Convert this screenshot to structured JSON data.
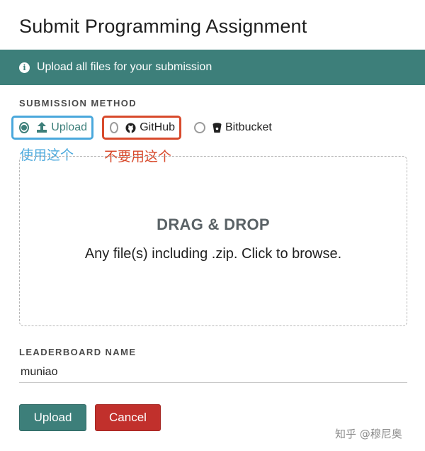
{
  "modal": {
    "title": "Submit Programming Assignment"
  },
  "banner": {
    "icon": "info-icon",
    "text": "Upload all files for your submission",
    "color": "#3d7f7a"
  },
  "submission_method": {
    "label": "SUBMISSION METHOD",
    "options": [
      {
        "label": "Upload",
        "icon": "upload-icon",
        "selected": true
      },
      {
        "label": "GitHub",
        "icon": "github-icon",
        "selected": false
      },
      {
        "label": "Bitbucket",
        "icon": "bitbucket-icon",
        "selected": false
      }
    ]
  },
  "annotations": {
    "use_this": "使用这个",
    "dont_use_this": "不要用这个",
    "use_color": "#4aa8dc",
    "dont_use_color": "#d84a2c"
  },
  "dropzone": {
    "title": "DRAG & DROP",
    "subtitle": "Any file(s) including .zip. Click to browse."
  },
  "leaderboard": {
    "label": "LEADERBOARD NAME",
    "value": "muniao"
  },
  "buttons": {
    "upload": "Upload",
    "cancel": "Cancel",
    "upload_color": "#3d7f7a",
    "cancel_color": "#c1302c"
  },
  "watermark": {
    "text": "知乎 @穆尼奥"
  }
}
